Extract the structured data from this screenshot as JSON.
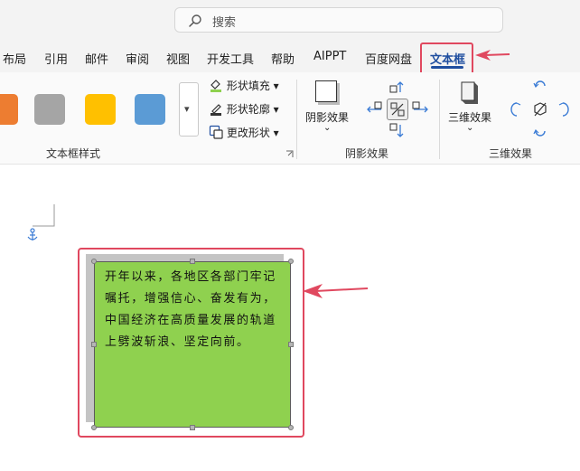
{
  "search": {
    "placeholder": "搜索"
  },
  "tabs": [
    {
      "label": "布局"
    },
    {
      "label": "引用"
    },
    {
      "label": "邮件"
    },
    {
      "label": "审阅"
    },
    {
      "label": "视图"
    },
    {
      "label": "开发工具"
    },
    {
      "label": "帮助"
    },
    {
      "label": "AIPPT"
    },
    {
      "label": "百度网盘"
    },
    {
      "label": "文本框"
    }
  ],
  "ribbon": {
    "textbox_styles": {
      "swatches": [
        "#ed7d31",
        "#a5a5a5",
        "#ffc000",
        "#5b9bd5"
      ],
      "shape_fill": "形状填充",
      "shape_outline": "形状轮廓",
      "change_shape": "更改形状",
      "group_label": "文本框样式"
    },
    "shadow": {
      "button_label": "阴影效果",
      "group_label": "阴影效果"
    },
    "three_d": {
      "button_label": "三维效果",
      "group_label": "三维效果"
    }
  },
  "document": {
    "textbox_text": "开年以来，各地区各部门牢记嘱托，增强信心、奋发有为，中国经济在高质量发展的轨道上劈波斩浪、坚定向前。",
    "textbox_fill": "#8fd14f"
  },
  "colors": {
    "annotation": "#e0485f",
    "active_tab": "#1f4e9f"
  }
}
